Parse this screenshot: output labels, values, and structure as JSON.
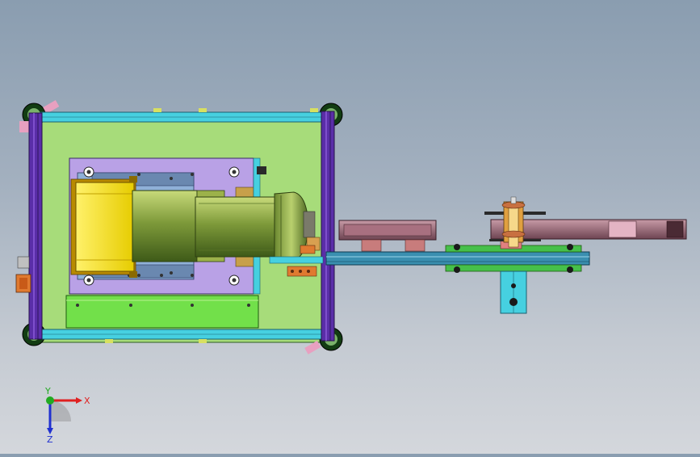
{
  "view": {
    "background_top": "#8a9db0",
    "background_bottom": "#d4d7dc"
  },
  "triad": {
    "x_label": "X",
    "y_label": "Y",
    "z_label": "Z",
    "x_color": "#e02020",
    "y_color": "#22aa22",
    "z_color": "#2030d0"
  },
  "colors": {
    "base_plate": "#a7dc7a",
    "frame_rail": "#46d0e0",
    "side_post": "#5a2ea8",
    "mount_plate": "#b9a1e6",
    "yellow_block": "#f5e614",
    "motor_body": "#7e9a3a",
    "arm": "#9a6a78",
    "conveyor": "#3a8fb0"
  }
}
